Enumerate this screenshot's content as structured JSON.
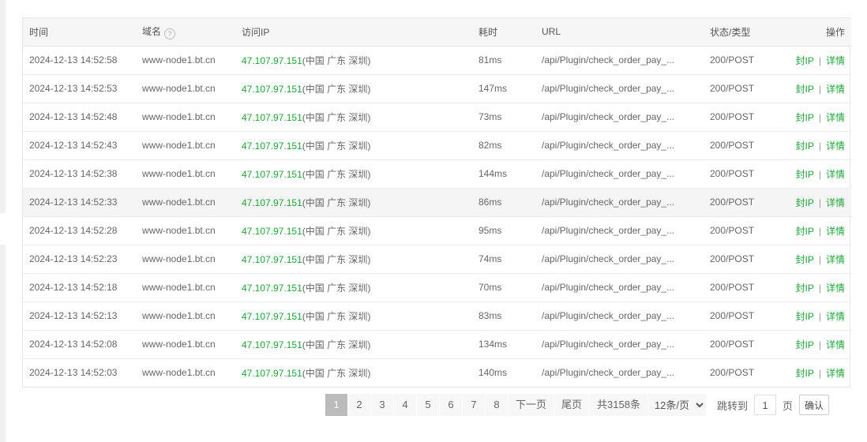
{
  "table": {
    "headers": {
      "time": "时间",
      "domain": "域名",
      "ip": "访问IP",
      "cost": "耗时",
      "url": "URL",
      "status": "状态/类型",
      "ops": "操作"
    },
    "help_icon": "?",
    "rows": [
      {
        "time": "2024-12-13 14:52:58",
        "domain": "www-node1.bt.cn",
        "ip": "47.107.97.151",
        "loc": "(中国 广东 深圳)",
        "cost": "81ms",
        "url": "/api/Plugin/check_order_pay_...",
        "status": "200/POST",
        "block": "封IP",
        "sep": "|",
        "detail": "详情"
      },
      {
        "time": "2024-12-13 14:52:53",
        "domain": "www-node1.bt.cn",
        "ip": "47.107.97.151",
        "loc": "(中国 广东 深圳)",
        "cost": "147ms",
        "url": "/api/Plugin/check_order_pay_...",
        "status": "200/POST",
        "block": "封IP",
        "sep": "|",
        "detail": "详情"
      },
      {
        "time": "2024-12-13 14:52:48",
        "domain": "www-node1.bt.cn",
        "ip": "47.107.97.151",
        "loc": "(中国 广东 深圳)",
        "cost": "73ms",
        "url": "/api/Plugin/check_order_pay_...",
        "status": "200/POST",
        "block": "封IP",
        "sep": "|",
        "detail": "详情"
      },
      {
        "time": "2024-12-13 14:52:43",
        "domain": "www-node1.bt.cn",
        "ip": "47.107.97.151",
        "loc": "(中国 广东 深圳)",
        "cost": "82ms",
        "url": "/api/Plugin/check_order_pay_...",
        "status": "200/POST",
        "block": "封IP",
        "sep": "|",
        "detail": "详情"
      },
      {
        "time": "2024-12-13 14:52:38",
        "domain": "www-node1.bt.cn",
        "ip": "47.107.97.151",
        "loc": "(中国 广东 深圳)",
        "cost": "144ms",
        "url": "/api/Plugin/check_order_pay_...",
        "status": "200/POST",
        "block": "封IP",
        "sep": "|",
        "detail": "详情"
      },
      {
        "time": "2024-12-13 14:52:33",
        "domain": "www-node1.bt.cn",
        "ip": "47.107.97.151",
        "loc": "(中国 广东 深圳)",
        "cost": "86ms",
        "url": "/api/Plugin/check_order_pay_...",
        "status": "200/POST",
        "block": "封IP",
        "sep": "|",
        "detail": "详情"
      },
      {
        "time": "2024-12-13 14:52:28",
        "domain": "www-node1.bt.cn",
        "ip": "47.107.97.151",
        "loc": "(中国 广东 深圳)",
        "cost": "95ms",
        "url": "/api/Plugin/check_order_pay_...",
        "status": "200/POST",
        "block": "封IP",
        "sep": "|",
        "detail": "详情"
      },
      {
        "time": "2024-12-13 14:52:23",
        "domain": "www-node1.bt.cn",
        "ip": "47.107.97.151",
        "loc": "(中国 广东 深圳)",
        "cost": "74ms",
        "url": "/api/Plugin/check_order_pay_...",
        "status": "200/POST",
        "block": "封IP",
        "sep": "|",
        "detail": "详情"
      },
      {
        "time": "2024-12-13 14:52:18",
        "domain": "www-node1.bt.cn",
        "ip": "47.107.97.151",
        "loc": "(中国 广东 深圳)",
        "cost": "70ms",
        "url": "/api/Plugin/check_order_pay_...",
        "status": "200/POST",
        "block": "封IP",
        "sep": "|",
        "detail": "详情"
      },
      {
        "time": "2024-12-13 14:52:13",
        "domain": "www-node1.bt.cn",
        "ip": "47.107.97.151",
        "loc": "(中国 广东 深圳)",
        "cost": "83ms",
        "url": "/api/Plugin/check_order_pay_...",
        "status": "200/POST",
        "block": "封IP",
        "sep": "|",
        "detail": "详情"
      },
      {
        "time": "2024-12-13 14:52:08",
        "domain": "www-node1.bt.cn",
        "ip": "47.107.97.151",
        "loc": "(中国 广东 深圳)",
        "cost": "134ms",
        "url": "/api/Plugin/check_order_pay_...",
        "status": "200/POST",
        "block": "封IP",
        "sep": "|",
        "detail": "详情"
      },
      {
        "time": "2024-12-13 14:52:03",
        "domain": "www-node1.bt.cn",
        "ip": "47.107.97.151",
        "loc": "(中国 广东 深圳)",
        "cost": "140ms",
        "url": "/api/Plugin/check_order_pay_...",
        "status": "200/POST",
        "block": "封IP",
        "sep": "|",
        "detail": "详情"
      }
    ]
  },
  "pagination": {
    "pages": [
      "1",
      "2",
      "3",
      "4",
      "5",
      "6",
      "7",
      "8"
    ],
    "current": "1",
    "next": "下一页",
    "last": "尾页",
    "total": "共3158条",
    "page_size": "12条/页",
    "jump_label": "跳转到",
    "jump_value": "1",
    "page_unit": "页",
    "confirm": "确认"
  }
}
